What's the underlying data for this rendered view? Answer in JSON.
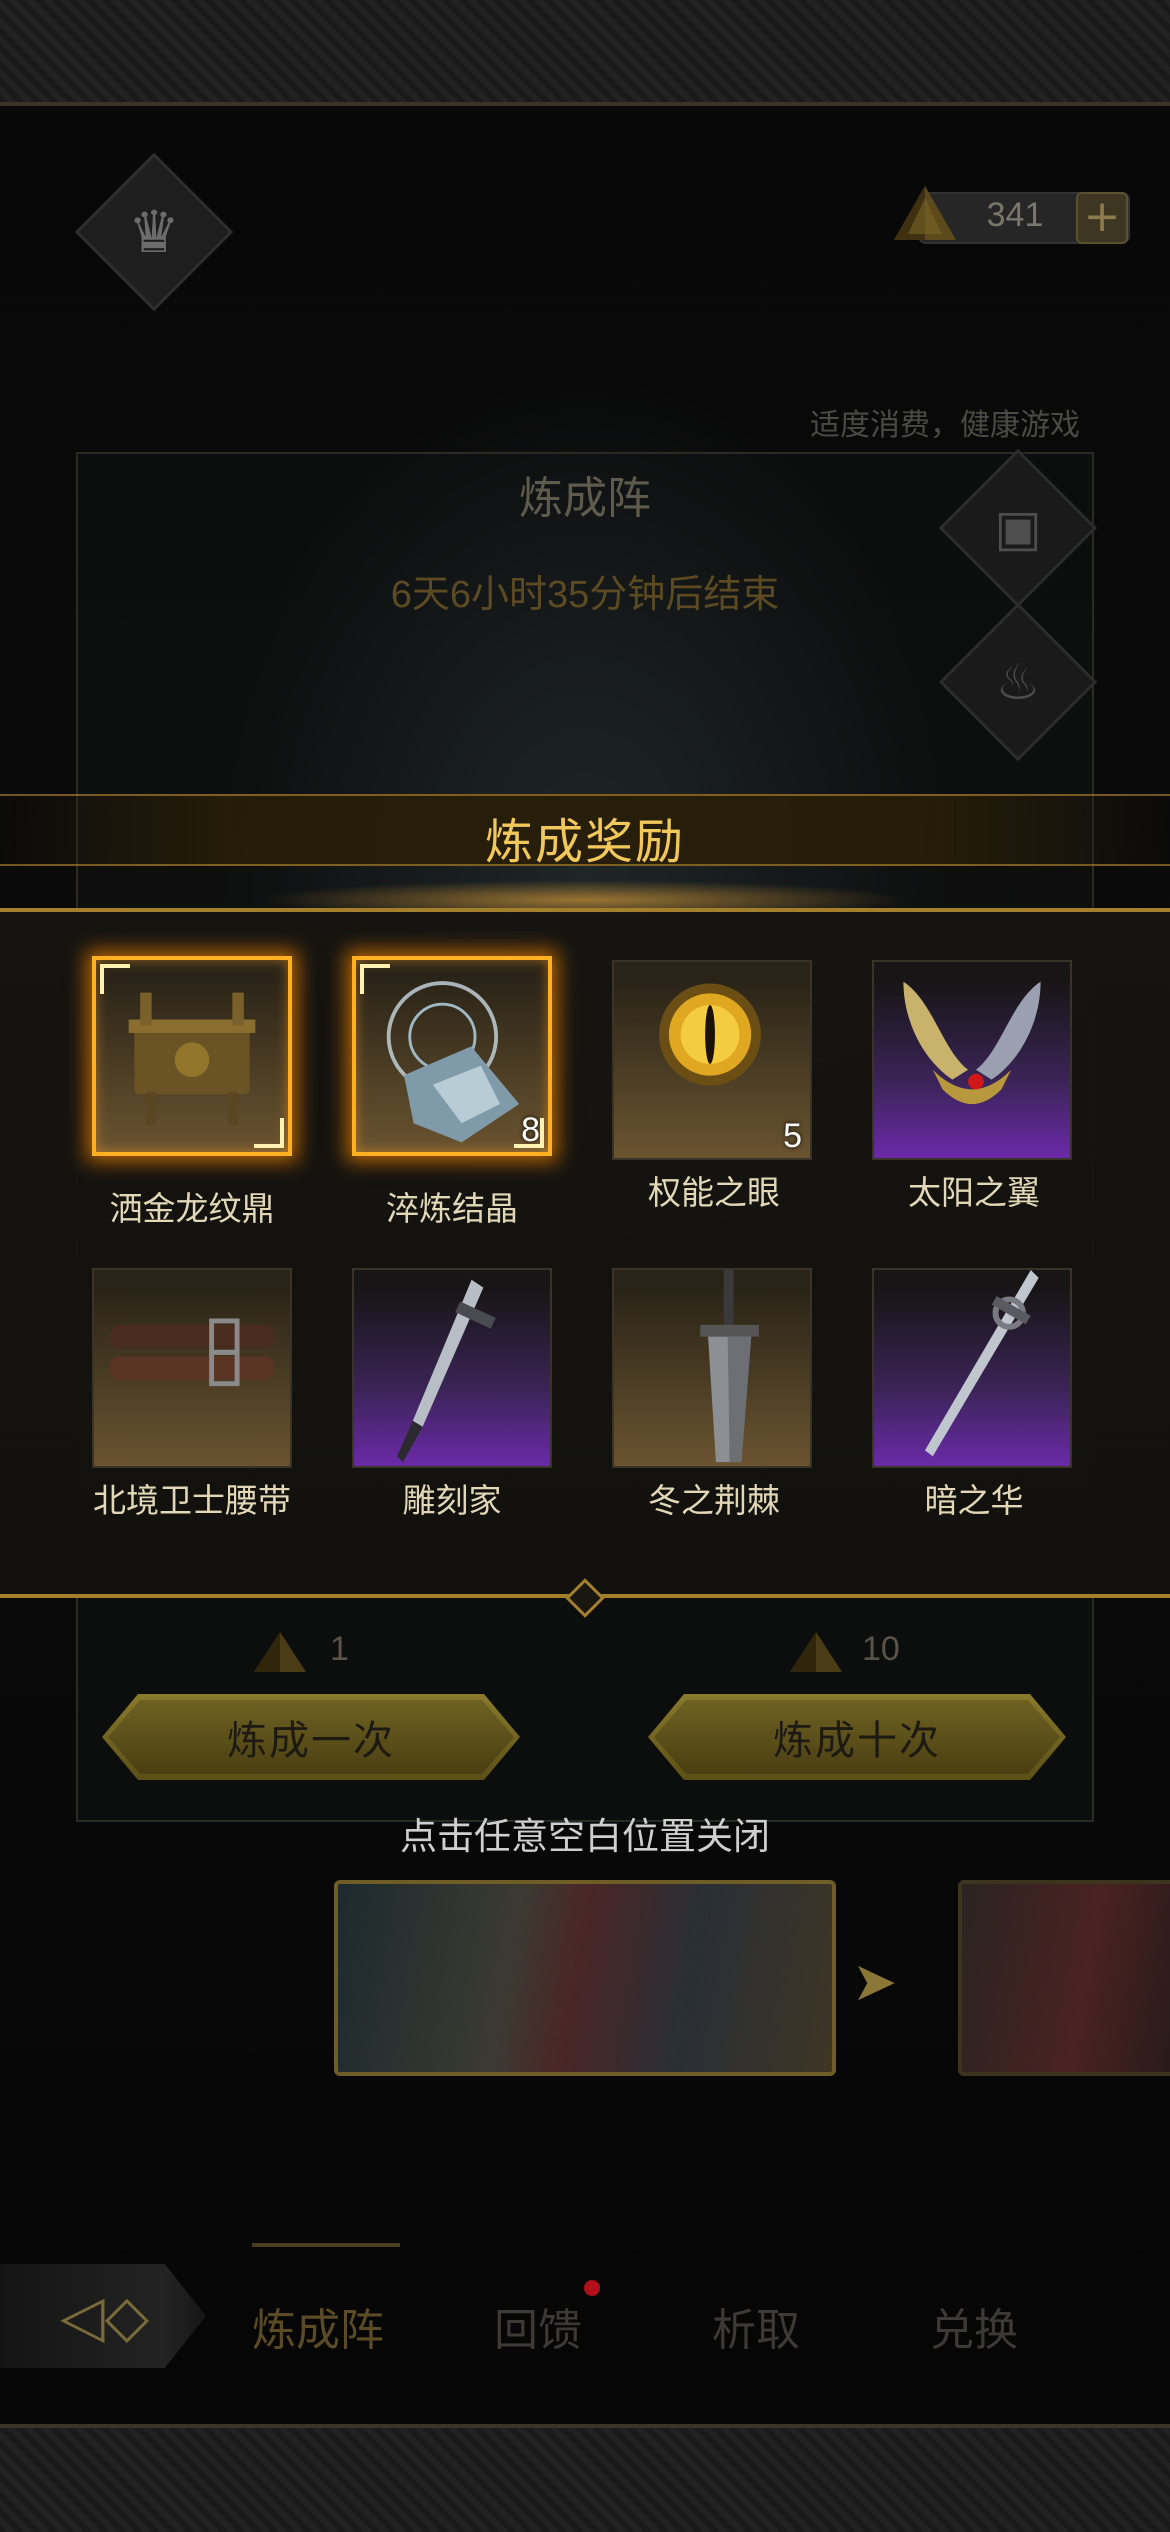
{
  "currency": {
    "value": "341",
    "icon": "pyramid-crystal-icon"
  },
  "health_note": "适度消费，健康游戏",
  "panel": {
    "title": "炼成阵",
    "timer": "6天6小时35分钟后结束"
  },
  "actions": {
    "once": {
      "label": "炼成一次",
      "cost": "1"
    },
    "ten": {
      "label": "炼成十次",
      "cost": "10"
    }
  },
  "close_hint": "点击任意空白位置关闭",
  "tabs": [
    {
      "label": "炼成阵",
      "active": true
    },
    {
      "label": "回馈",
      "badge": true
    },
    {
      "label": "析取"
    },
    {
      "label": "兑换"
    }
  ],
  "modal": {
    "title": "炼成奖励",
    "items": [
      {
        "name": "洒金龙纹鼎",
        "rarity": "legendary",
        "bg": "gold",
        "icon": "bronze-cauldron-icon"
      },
      {
        "name": "淬炼结晶",
        "rarity": "legendary",
        "bg": "gold",
        "icon": "ice-crystal-icon",
        "count": "8"
      },
      {
        "name": "权能之眼",
        "rarity": "rare",
        "bg": "gold",
        "icon": "golden-eye-icon",
        "count": "5"
      },
      {
        "name": "太阳之翼",
        "rarity": "epic",
        "bg": "purple",
        "icon": "winged-helmet-icon"
      },
      {
        "name": "北境卫士腰带",
        "rarity": "rare",
        "bg": "gold",
        "icon": "leather-belt-icon"
      },
      {
        "name": "雕刻家",
        "rarity": "epic",
        "bg": "purple",
        "icon": "dagger-icon"
      },
      {
        "name": "冬之荆棘",
        "rarity": "rare",
        "bg": "gold",
        "icon": "greatsword-icon"
      },
      {
        "name": "暗之华",
        "rarity": "epic",
        "bg": "purple",
        "icon": "rapier-icon"
      }
    ]
  },
  "colors": {
    "gold_title": "#f2c85a",
    "legendary_border": "#ffb020",
    "epic_purple": "#6a2aa8",
    "badge_red": "#b0101a"
  }
}
